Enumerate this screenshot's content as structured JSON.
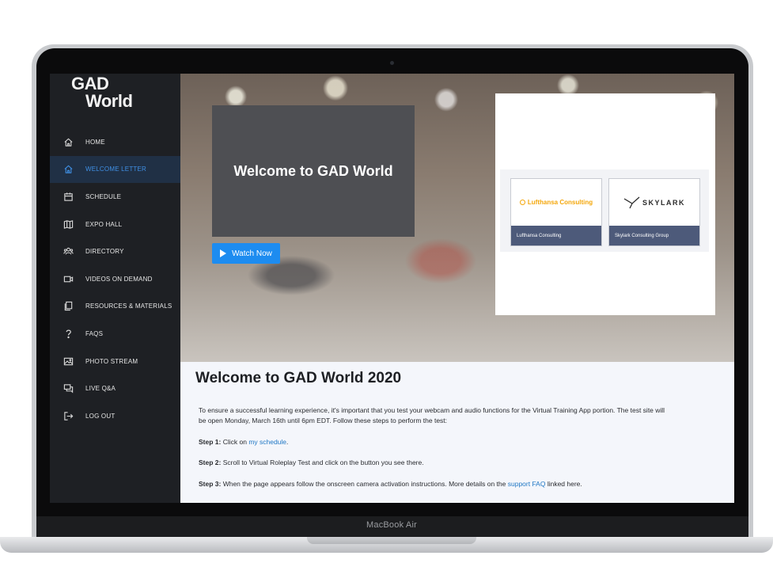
{
  "device": {
    "brand_label": "MacBook Air"
  },
  "sidebar": {
    "logo_line1": "GAD",
    "logo_line2": "World",
    "items": [
      {
        "label": "HOME",
        "icon": "home-icon"
      },
      {
        "label": "WELCOME LETTER",
        "icon": "home-icon",
        "active": true
      },
      {
        "label": "SCHEDULE",
        "icon": "calendar-icon"
      },
      {
        "label": "EXPO HALL",
        "icon": "map-icon"
      },
      {
        "label": "DIRECTORY",
        "icon": "people-icon"
      },
      {
        "label": "VIDEOS ON DEMAND",
        "icon": "video-icon"
      },
      {
        "label": "RESOURCES & MATERIALS",
        "icon": "documents-icon"
      },
      {
        "label": "FAQS",
        "icon": "question-icon"
      },
      {
        "label": "PHOTO STREAM",
        "icon": "image-icon"
      },
      {
        "label": "LIVE Q&A",
        "icon": "chat-icon"
      },
      {
        "label": "LOG OUT",
        "icon": "logout-icon"
      }
    ]
  },
  "hero": {
    "card_title": "Welcome to GAD World",
    "watch_label": "Watch Now",
    "sponsors": [
      {
        "logo_text": "Lufthansa Consulting",
        "caption": "Lufthansa Consulting"
      },
      {
        "logo_text": "SKYLARK",
        "caption": "Skylark Consulting Group"
      }
    ]
  },
  "content": {
    "title": "Welcome to GAD World 2020",
    "intro_line1": "To ensure a successful learning experience, it's important that you test your webcam and audio functions for the Virtual Training App portion. The test site will",
    "intro_line2": "be open Monday, March 16th until 6pm EDT. Follow these steps to perform the test:",
    "step1_label": "Step 1:",
    "step1_text": " Click on ",
    "step1_link": "my schedule",
    "step1_end": ".",
    "step2_label": "Step 2:",
    "step2_text": " Scroll to Virtual Roleplay Test and click on the button you see there.",
    "step3_label": "Step 3:",
    "step3_text": " When the page appears follow the onscreen camera activation instructions. More details on the ",
    "step3_link": "support FAQ",
    "step3_end": " linked here."
  },
  "colors": {
    "accent": "#1d8cf0",
    "sidebar_active_text": "#3f8fe4",
    "sidebar_bg": "#1e2024"
  }
}
